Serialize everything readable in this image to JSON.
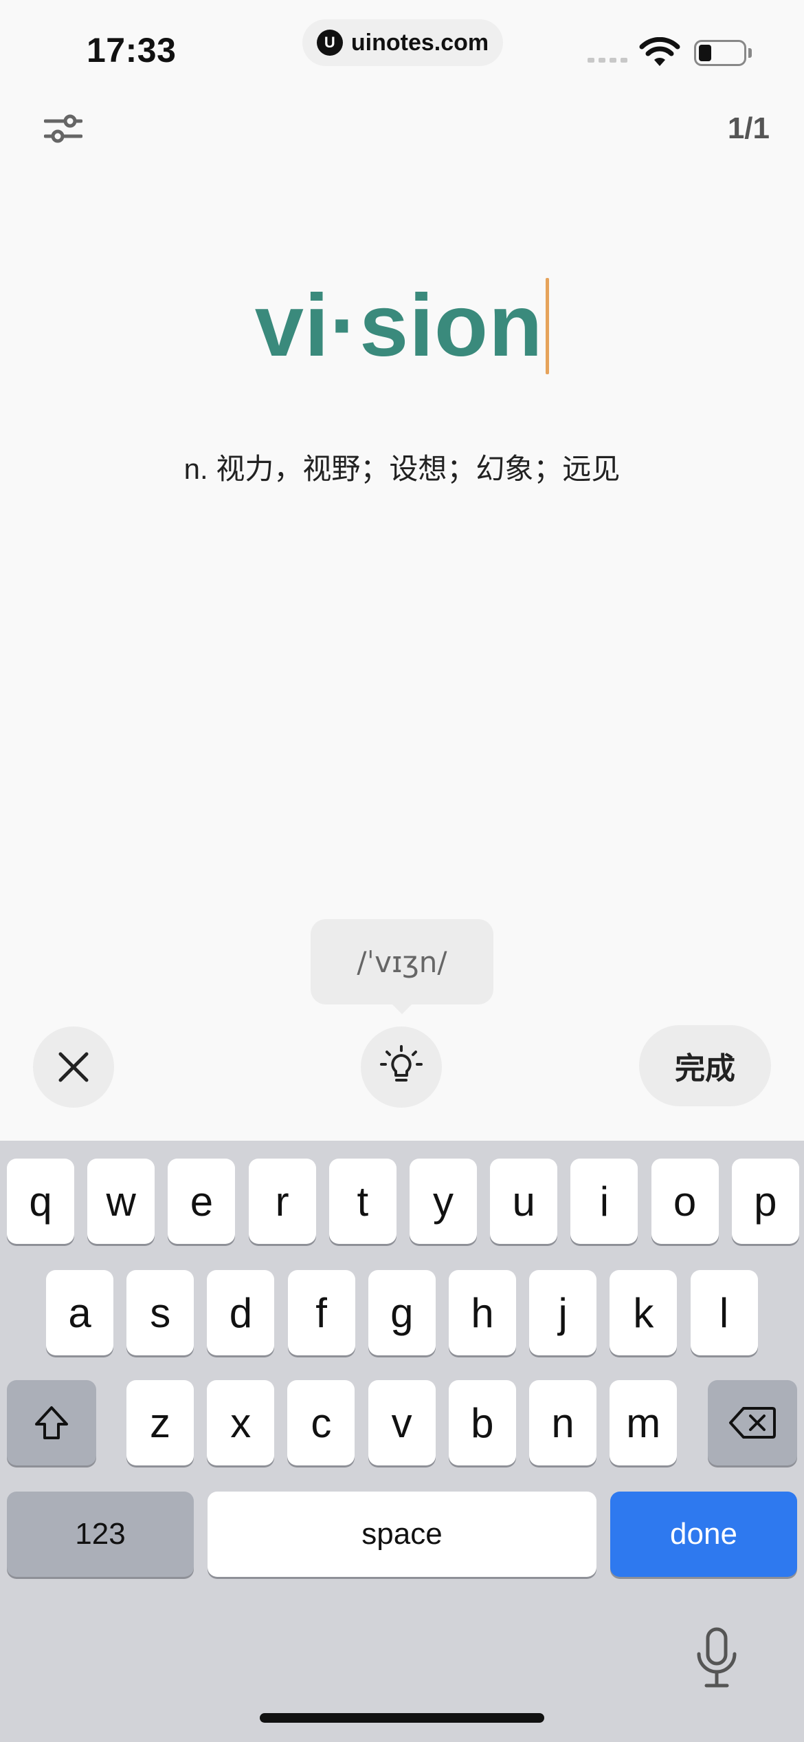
{
  "status_bar": {
    "time": "17:33",
    "url": "uinotes.com",
    "logo_letter": "U",
    "wifi_icon": "wifi-icon",
    "battery_icon": "battery-icon"
  },
  "top_bar": {
    "filter_icon": "sliders-icon",
    "counter": "1/1"
  },
  "card": {
    "word": "vi·sion",
    "definition": "n. 视力，视野；设想；幻象；远见"
  },
  "hint": {
    "phonetic": "/ˈvɪʒn/"
  },
  "actions": {
    "close_icon": "close-icon",
    "hint_icon": "lightbulb-icon",
    "finish_label": "完成"
  },
  "keyboard": {
    "row1": [
      "q",
      "w",
      "e",
      "r",
      "t",
      "y",
      "u",
      "i",
      "o",
      "p"
    ],
    "row2": [
      "a",
      "s",
      "d",
      "f",
      "g",
      "h",
      "j",
      "k",
      "l"
    ],
    "row3": [
      "z",
      "x",
      "c",
      "v",
      "b",
      "n",
      "m"
    ],
    "shift_icon": "shift-icon",
    "delete_icon": "backspace-icon",
    "numbers_label": "123",
    "space_label": "space",
    "done_label": "done",
    "mic_icon": "microphone-icon",
    "accent_color": "#2e79ef"
  },
  "colors": {
    "word": "#3a8a7c",
    "caret": "#e6a35b"
  }
}
